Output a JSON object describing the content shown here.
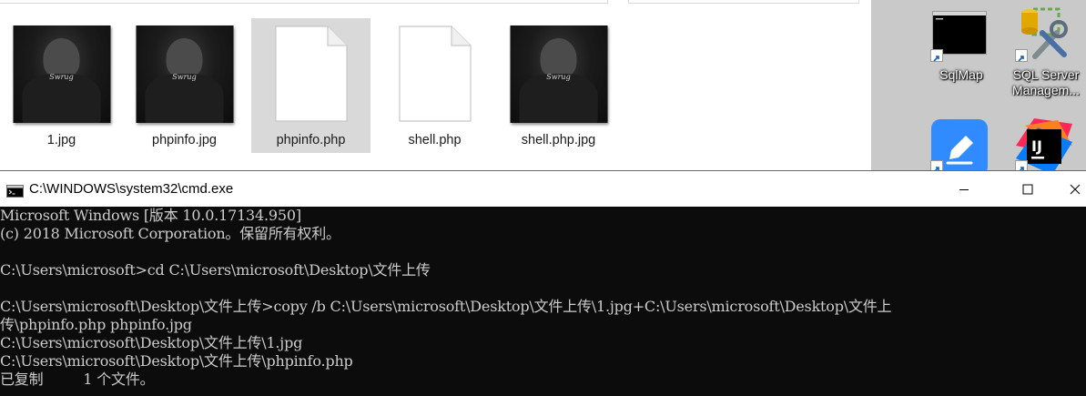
{
  "explorer": {
    "files": [
      {
        "name": "1.jpg",
        "kind": "image",
        "signature": "Swrug"
      },
      {
        "name": "phpinfo.jpg",
        "kind": "image",
        "signature": "Swrug"
      },
      {
        "name": "phpinfo.php",
        "kind": "document",
        "selected": true
      },
      {
        "name": "shell.php",
        "kind": "document"
      },
      {
        "name": "shell.php.jpg",
        "kind": "image",
        "signature": "Swrug"
      }
    ]
  },
  "desktop": {
    "icons": [
      {
        "label": "SqlMap",
        "icon": "console-icon"
      },
      {
        "label": "SQL Server\nManagem...",
        "icon": "sql-server-tools-icon"
      },
      {
        "label": "",
        "icon": "edit-pencil-app-icon"
      },
      {
        "label": "",
        "icon": "intellij-icon"
      }
    ]
  },
  "cmd": {
    "title": "C:\\WINDOWS\\system32\\cmd.exe",
    "colors": {
      "background": "#0c0c0c",
      "text": "#cccccc"
    },
    "lines": [
      "Microsoft Windows [版本 10.0.17134.950]",
      "(c) 2018 Microsoft Corporation。保留所有权利。",
      "",
      "C:\\Users\\microsoft>cd C:\\Users\\microsoft\\Desktop\\文件上传",
      "",
      "C:\\Users\\microsoft\\Desktop\\文件上传>copy /b C:\\Users\\microsoft\\Desktop\\文件上传\\1.jpg+C:\\Users\\microsoft\\Desktop\\文件上",
      "传\\phpinfo.php phpinfo.jpg",
      "C:\\Users\\microsoft\\Desktop\\文件上传\\1.jpg",
      "C:\\Users\\microsoft\\Desktop\\文件上传\\phpinfo.php",
      "已复制         1 个文件。"
    ]
  }
}
